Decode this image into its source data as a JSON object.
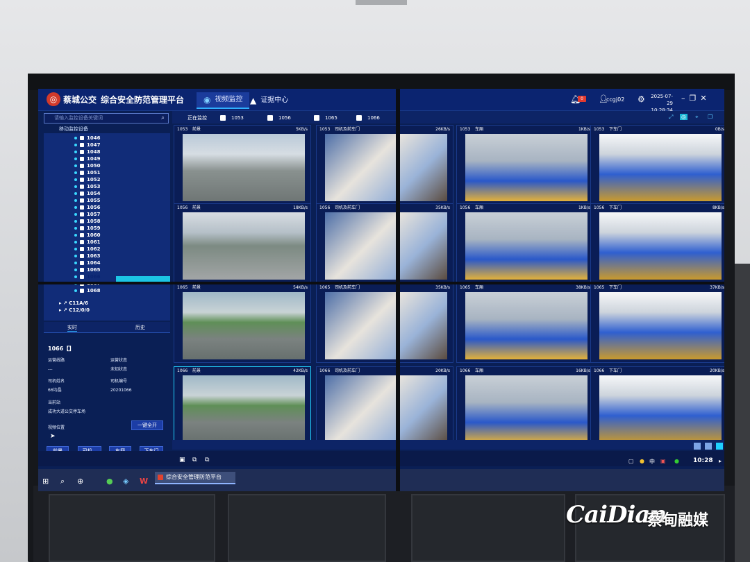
{
  "header": {
    "brand": "蔡城公交",
    "title": "综合安全防范管理平台",
    "tabs": [
      {
        "label": "视频监控",
        "active": true,
        "icon": "camera-icon"
      },
      {
        "label": "证据中心",
        "active": false,
        "icon": "warning-icon"
      }
    ],
    "alert_badge": "0",
    "user": "ccgj02",
    "date": "2025-07-29",
    "time": "10:28:34"
  },
  "sidebar": {
    "search_placeholder": "请输入监控设备关键词",
    "tree_label": "移动监控设备",
    "items": [
      "1046",
      "1047",
      "1048",
      "1049",
      "1050",
      "1051",
      "1052",
      "1053",
      "1054",
      "1055",
      "1056",
      "1057",
      "1058",
      "1059",
      "1060",
      "1061",
      "1062",
      "1063",
      "1064",
      "1065",
      "1066",
      "1067",
      "1068"
    ],
    "selected": "1066",
    "groups": [
      "C11A/6",
      "C12/0/0"
    ],
    "subtabs": [
      "实时",
      "历史"
    ]
  },
  "detail": {
    "title": "1066【】",
    "rows": [
      {
        "label": "运营线路",
        "value": "---"
      },
      {
        "label": "运营状态",
        "value": "未知状态"
      },
      {
        "label": "司机姓名",
        "value": "66均晶"
      },
      {
        "label": "司机编号",
        "value": "20201066"
      },
      {
        "label": "当前站",
        "value": "成功大道公交停车场"
      }
    ],
    "location_label": "视频位置",
    "open_all_button": "一键全开",
    "camera_buttons": [
      "前景",
      "司机...",
      "车厢",
      "下车门"
    ]
  },
  "monitor": {
    "label": "正在监控",
    "tabs": [
      "1053",
      "1056",
      "1065",
      "1066"
    ]
  },
  "grid": [
    {
      "bus": "1053",
      "cam": "前景",
      "rate": "5KB/s",
      "style": "v-front"
    },
    {
      "bus": "1053",
      "cam": "司机及前车门",
      "rate": "26KB/s",
      "style": "v-driver"
    },
    {
      "bus": "1053",
      "cam": "车厢",
      "rate": "1KB/s",
      "style": "v-car"
    },
    {
      "bus": "1053",
      "cam": "下车门",
      "rate": "0B/s",
      "style": "v-rear"
    },
    {
      "bus": "1056",
      "cam": "前景",
      "rate": "18KB/s",
      "style": "v-street"
    },
    {
      "bus": "1056",
      "cam": "司机及前车门",
      "rate": "35KB/s",
      "style": "v-driver"
    },
    {
      "bus": "1056",
      "cam": "车厢",
      "rate": "1KB/s",
      "style": "v-car"
    },
    {
      "bus": "1056",
      "cam": "下车门",
      "rate": "8KB/s",
      "style": "v-rear"
    },
    {
      "bus": "1065",
      "cam": "前景",
      "rate": "54KB/s",
      "style": "v-front-g"
    },
    {
      "bus": "1065",
      "cam": "司机及前车门",
      "rate": "35KB/s",
      "style": "v-driver"
    },
    {
      "bus": "1065",
      "cam": "车厢",
      "rate": "38KB/s",
      "style": "v-car"
    },
    {
      "bus": "1065",
      "cam": "下车门",
      "rate": "37KB/s",
      "style": "v-rear"
    },
    {
      "bus": "1066",
      "cam": "前景",
      "rate": "42KB/s",
      "style": "v-front-g",
      "selected": true
    },
    {
      "bus": "1066",
      "cam": "司机及前车门",
      "rate": "20KB/s",
      "style": "v-driver"
    },
    {
      "bus": "1066",
      "cam": "车厢",
      "rate": "16KB/s",
      "style": "v-car"
    },
    {
      "bus": "1066",
      "cam": "下车门",
      "rate": "20KB/s",
      "style": "v-rear"
    }
  ],
  "taskbar": {
    "app_title": "综合安全管理防范平台",
    "clock": "10:28",
    "ime": "中"
  },
  "watermark": {
    "latin": "CaiDian",
    "chinese": "蔡甸融媒"
  },
  "colors": {
    "panel": "#0a1f55",
    "accent": "#1cc5e5",
    "alert": "#e23a30"
  }
}
